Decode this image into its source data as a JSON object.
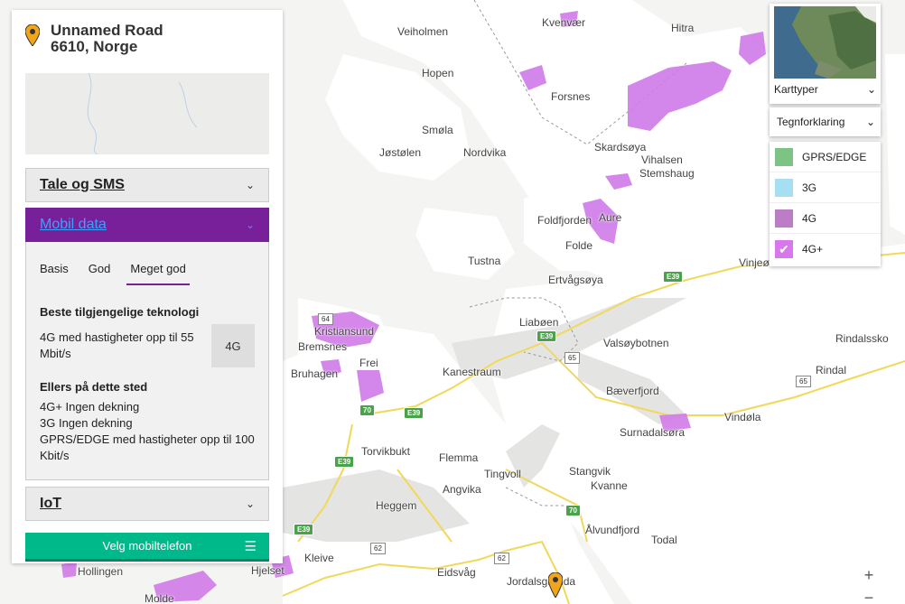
{
  "address": {
    "line1": "Unnamed Road",
    "line2": "6610, Norge"
  },
  "sections": {
    "tale": "Tale og SMS",
    "mobil": "Mobil data",
    "iot": "IoT"
  },
  "tabs": [
    "Basis",
    "God",
    "Meget god"
  ],
  "active_tab": "Meget god",
  "best_tech": {
    "title": "Beste tilgjengelige teknologi",
    "desc": "4G med hastigheter opp til 55 Mbit/s",
    "badge": "4G"
  },
  "other": {
    "title": "Ellers på dette sted",
    "items": [
      "4G+ Ingen dekning",
      "3G Ingen dekning",
      "GPRS/EDGE med hastigheter opp til 100 Kbit/s"
    ]
  },
  "select_phone": "Velg mobiltelefon",
  "map_controls": {
    "map_types": "Karttyper",
    "legend_toggle": "Tegnforklaring",
    "zoom_in": "+",
    "zoom_out": "−"
  },
  "legend": [
    {
      "label": "GPRS/EDGE",
      "color": "#7dc383",
      "checked": false
    },
    {
      "label": "3G",
      "color": "#a6def2",
      "checked": false
    },
    {
      "label": "4G",
      "color": "#bd7dc6",
      "checked": false
    },
    {
      "label": "4G+",
      "color": "#d978ec",
      "checked": true
    }
  ],
  "places": {
    "veiholmen": "Veiholmen",
    "kvenvaer": "Kvenvær",
    "hitra": "Hitra",
    "hopen": "Hopen",
    "forsnes": "Forsnes",
    "smola": "Smøla",
    "jostolen": "Jøstølen",
    "nordvika": "Nordvika",
    "skardsoya": "Skardsøya",
    "vihalsen": "Vihalsen",
    "stemshaug": "Stemshaug",
    "foldfjorden": "Foldfjorden",
    "aure": "Aure",
    "folde": "Folde",
    "tustna": "Tustna",
    "ertvagsoya": "Ertvågsøya",
    "vinjeora": "Vinjeø",
    "kristiansund": "Kristiansund",
    "bremsnes": "Bremsnes",
    "bruhagen": "Bruhagen",
    "frei": "Frei",
    "liaboen": "Liabøen",
    "valsoybotnen": "Valsøybotnen",
    "rindalsskog": "Rindalssko",
    "kanestraum": "Kanestraum",
    "rindal": "Rindal",
    "baeverfjord": "Bæverfjord",
    "surnadalsora": "Surnadalsøra",
    "vindola": "Vindøla",
    "torvikbukt": "Torvikbukt",
    "flemma": "Flemma",
    "tingvoll": "Tingvoll",
    "stangvik": "Stangvik",
    "kvanne": "Kvanne",
    "heggem": "Heggem",
    "angvika": "Angvika",
    "alvundfjord": "Ålvundfjord",
    "todal": "Todal",
    "kleive": "Kleive",
    "hollingen": "Hollingen",
    "hjelset": "Hjelset",
    "eidsvag": "Eidsvåg",
    "jordalsgrenda": "Jordalsgrenda",
    "molde": "Molde"
  },
  "roads": {
    "e39": "E39",
    "r70": "70",
    "r64": "64",
    "r65": "65",
    "r62": "62"
  }
}
